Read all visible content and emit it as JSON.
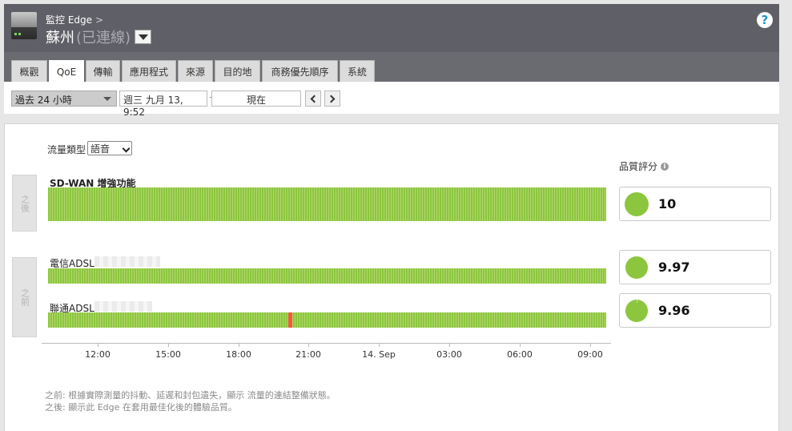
{
  "header": {
    "breadcrumb": "監控 Edge",
    "breadcrumb_sep": ">",
    "site_name": "蘇州",
    "site_status": "(已連線)",
    "help_label": "?"
  },
  "tabs": [
    {
      "label": "概觀"
    },
    {
      "label": "QoE",
      "active": true
    },
    {
      "label": "傳輸"
    },
    {
      "label": "應用程式"
    },
    {
      "label": "來源"
    },
    {
      "label": "目的地"
    },
    {
      "label": "商務優先順序"
    },
    {
      "label": "系統"
    }
  ],
  "filter": {
    "range": "過去 24 小時",
    "start": "週三 九月 13, 9:52",
    "end": "現在"
  },
  "traffic": {
    "label": "流量類型",
    "value": "語音"
  },
  "sections": {
    "after": "之後",
    "before": "之前"
  },
  "links": [
    {
      "name": "SD-WAN 增強功能",
      "score": "10",
      "score_fraction": 1.0,
      "bad_segments": []
    },
    {
      "name": "電信ADSL",
      "score": "9.97",
      "score_fraction": 0.997,
      "bad_segments": []
    },
    {
      "name": "聯通ADSL",
      "score": "9.96",
      "score_fraction": 0.996,
      "bad_segments": [
        "20:20"
      ]
    }
  ],
  "score_title": "品質評分",
  "axis_ticks": [
    "12:00",
    "15:00",
    "18:00",
    "21:00",
    "14. Sep",
    "03:00",
    "06:00",
    "09:00"
  ],
  "footnotes": {
    "before": "之前: 根據實際測量的抖動、延遲和封包遺失，顯示 流量的連結整備狀態。",
    "after": "之後: 顯示此 Edge 在套用最佳化後的體驗品質。"
  },
  "colors": {
    "good": "#8cc63f",
    "bad": "#f15a3b",
    "header": "#5f5f67",
    "tabbar": "#6a6a71",
    "help": "#2294c6"
  }
}
